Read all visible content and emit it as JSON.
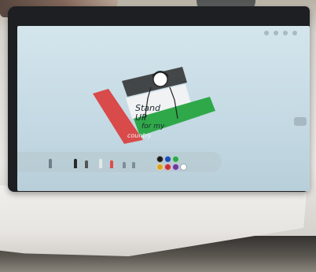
{
  "scene": {
    "description_label": "",
    "drawing_text": {
      "line1": "Stand",
      "line2": "UP",
      "line3": "for my",
      "line4": "country"
    },
    "flag_colors": {
      "red": "#d94a4a",
      "white": "#f4f4f4",
      "green": "#2fa84a",
      "black": "#2b2b2b"
    },
    "palette_colors": [
      "#1b1b1b",
      "#1f4fb3",
      "#2fa84a",
      "#d9a326",
      "#c9313a",
      "#6a3aa0",
      "#ffffff"
    ]
  }
}
